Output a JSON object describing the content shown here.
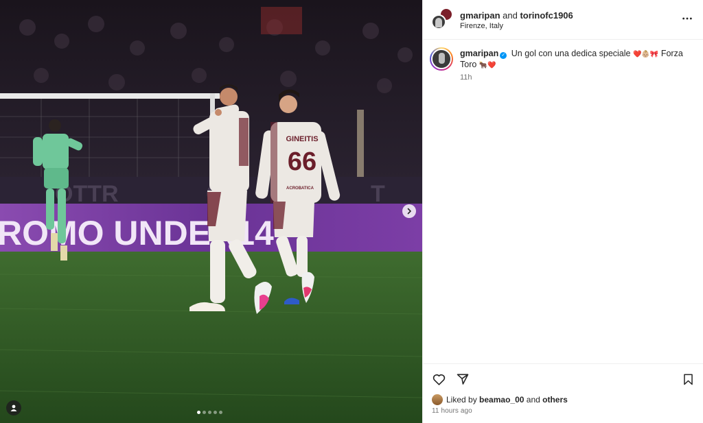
{
  "post": {
    "header": {
      "author": "gmaripan",
      "joiner": "and",
      "collaborator": "torinofc1906",
      "location": "Firenze, Italy",
      "more_icon": "more-horizontal-icon"
    },
    "caption": {
      "username": "gmaripan",
      "verified_icon": "verified-badge-icon",
      "text": "Un gol con una dedica speciale",
      "emojis_1": "❤️👶🏼🎀",
      "text_2": "Forza Toro",
      "emojis_2": "🐂❤️",
      "time": "11h"
    },
    "likes": {
      "prefix": "Liked by",
      "user": "beamao_00",
      "joiner": "and",
      "others": "others"
    },
    "timestamp": "11 hours ago",
    "carousel": {
      "slide_count": 5,
      "active_index": 0,
      "next_icon": "chevron-right-icon",
      "tag_icon": "user-tag-icon"
    },
    "photo": {
      "banner_text": "ROMO UNDER14",
      "player_name": "GINEITIS",
      "player_number": "66",
      "sponsor": "ACROBATICA",
      "colors": {
        "kit": "#ece8e3",
        "trim": "#6b1e2a",
        "pitch": "#2e5a24",
        "banner": "#7a3aa0"
      }
    }
  },
  "icons": {
    "like": "heart-icon",
    "share": "send-icon",
    "save": "bookmark-icon"
  }
}
